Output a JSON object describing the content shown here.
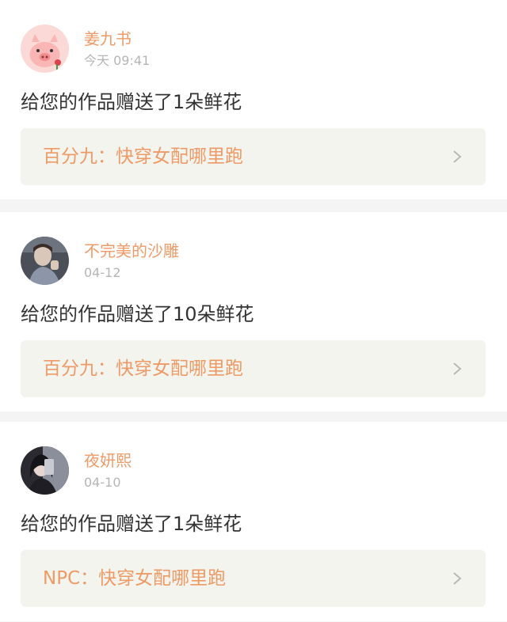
{
  "notifications": [
    {
      "username": "姜九书",
      "time": "今天 09:41",
      "message": "给您的作品赠送了1朵鲜花",
      "work_title": "百分九：快穿女配哪里跑",
      "avatar_icon": "pig-avatar"
    },
    {
      "username": "不完美的沙雕",
      "time": "04-12",
      "message": "给您的作品赠送了10朵鲜花",
      "work_title": "百分九：快穿女配哪里跑",
      "avatar_icon": "person-photo-avatar"
    },
    {
      "username": "夜妍熙",
      "time": "04-10",
      "message": "给您的作品赠送了1朵鲜花",
      "work_title": "NPC：快穿女配哪里跑",
      "avatar_icon": "person-photo-avatar"
    }
  ],
  "colors": {
    "accent": "#ee9a66",
    "time": "#b5b5b5",
    "text": "#333333",
    "link_bg": "#f4f4ee",
    "separator": "#f4f4f4"
  },
  "icons": {
    "chevron": "chevron-right-icon"
  }
}
